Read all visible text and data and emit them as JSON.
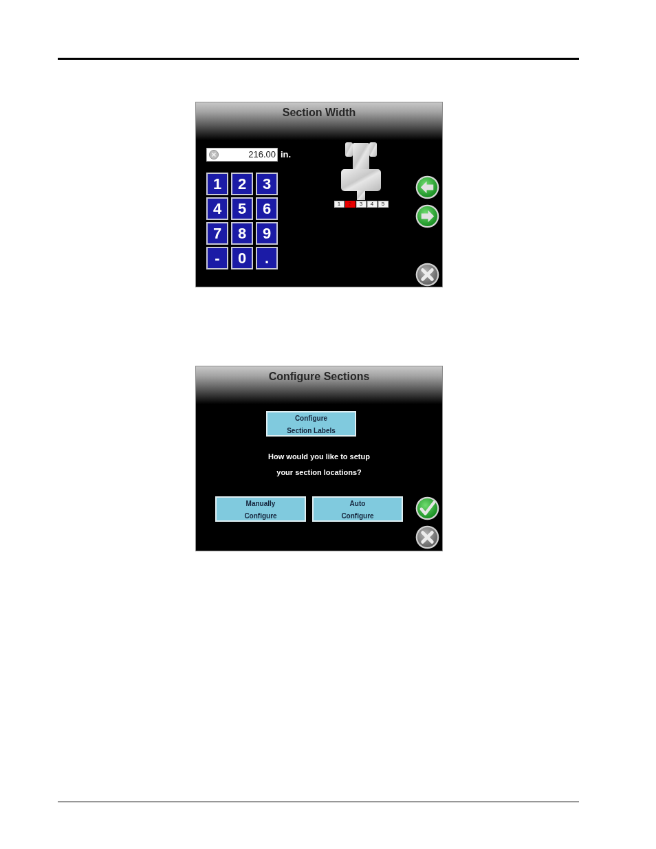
{
  "section_width_screen": {
    "title": "Section Width",
    "field": {
      "value": "216.00",
      "unit": "in."
    },
    "keypad": [
      "1",
      "2",
      "3",
      "4",
      "5",
      "6",
      "7",
      "8",
      "9",
      "-",
      "0",
      "."
    ],
    "sections": [
      {
        "label": "1",
        "selected": false
      },
      {
        "label": "2",
        "selected": true
      },
      {
        "label": "3",
        "selected": false
      },
      {
        "label": "4",
        "selected": false
      },
      {
        "label": "5",
        "selected": false
      }
    ]
  },
  "configure_sections_screen": {
    "title": "Configure Sections",
    "top_button": {
      "lines": [
        "Configure",
        "Section Labels"
      ]
    },
    "prompt_lines": [
      "How would you like to setup",
      "your section locations?"
    ],
    "buttons": [
      {
        "lines": [
          "Manually",
          "Configure"
        ]
      },
      {
        "lines": [
          "Auto",
          "Configure"
        ]
      }
    ]
  }
}
